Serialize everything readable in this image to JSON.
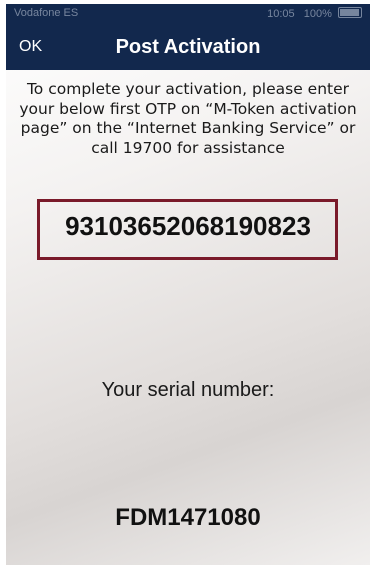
{
  "status_bar": {
    "carrier": "Vodafone ES",
    "time": "10:05",
    "battery": "100%"
  },
  "nav": {
    "left_button": "OK",
    "title": "Post Activation"
  },
  "content": {
    "instructions": "To complete your activation, please enter your below first OTP on “M-Token activation page” on the “Internet Banking Service” or call 19700 for assistance",
    "otp": "93103652068190823",
    "serial_label": "Your serial number:",
    "serial_value": "FDM1471080"
  },
  "colors": {
    "nav_background": "#12284d",
    "otp_border": "#7a1a2a",
    "text": "#1a1a1a"
  }
}
